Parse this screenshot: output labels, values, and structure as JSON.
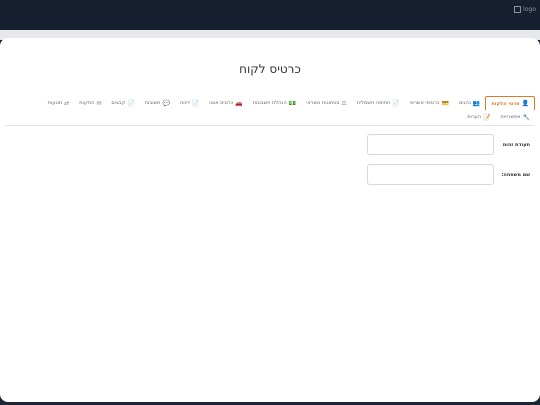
{
  "logo": {
    "alt": "logo"
  },
  "page": {
    "title": "כרטיס לקוח"
  },
  "tabs": [
    {
      "label": "פרטי הלקוח",
      "icon": "user-icon",
      "glyph": "👤",
      "active": true
    },
    {
      "label": "נהגים",
      "icon": "users-icon",
      "glyph": "👥",
      "active": false
    },
    {
      "label": "כרטיסי אשראי",
      "icon": "credit-card-icon",
      "glyph": "💳",
      "active": false
    },
    {
      "label": "חתימה חשמלית",
      "icon": "file-icon",
      "glyph": "📄",
      "active": false
    },
    {
      "label": "בטחונות אשראי",
      "icon": "balance-icon",
      "glyph": "⚖",
      "active": false
    },
    {
      "label": "הנהלת חשבונות",
      "icon": "money-icon",
      "glyph": "💵",
      "active": false
    },
    {
      "label": "כרטיס אוטו",
      "icon": "car-icon",
      "glyph": "🚗",
      "active": false
    },
    {
      "label": "דיווח",
      "icon": "document-icon",
      "glyph": "📄",
      "active": false
    },
    {
      "label": "תשובות",
      "icon": "comments-icon",
      "glyph": "💬",
      "active": false
    },
    {
      "label": "קבצים",
      "icon": "file-icon",
      "glyph": "📄",
      "active": false
    },
    {
      "label": "הודעות",
      "icon": "envelope-icon",
      "glyph": "✉",
      "active": false
    },
    {
      "label": "תנועות",
      "icon": "exchange-icon",
      "glyph": "⇄",
      "active": false
    },
    {
      "label": "אפשרויות",
      "icon": "wrench-icon",
      "glyph": "🔧",
      "active": false
    },
    {
      "label": "הערות",
      "icon": "note-icon",
      "glyph": "📝",
      "active": false
    }
  ],
  "form": {
    "id_label": "תעודת זהות",
    "id_value": "",
    "lastname_label": "שם משפחה:",
    "lastname_value": ""
  },
  "colors": {
    "accent": "#e07a2a",
    "topbar": "#172030"
  }
}
